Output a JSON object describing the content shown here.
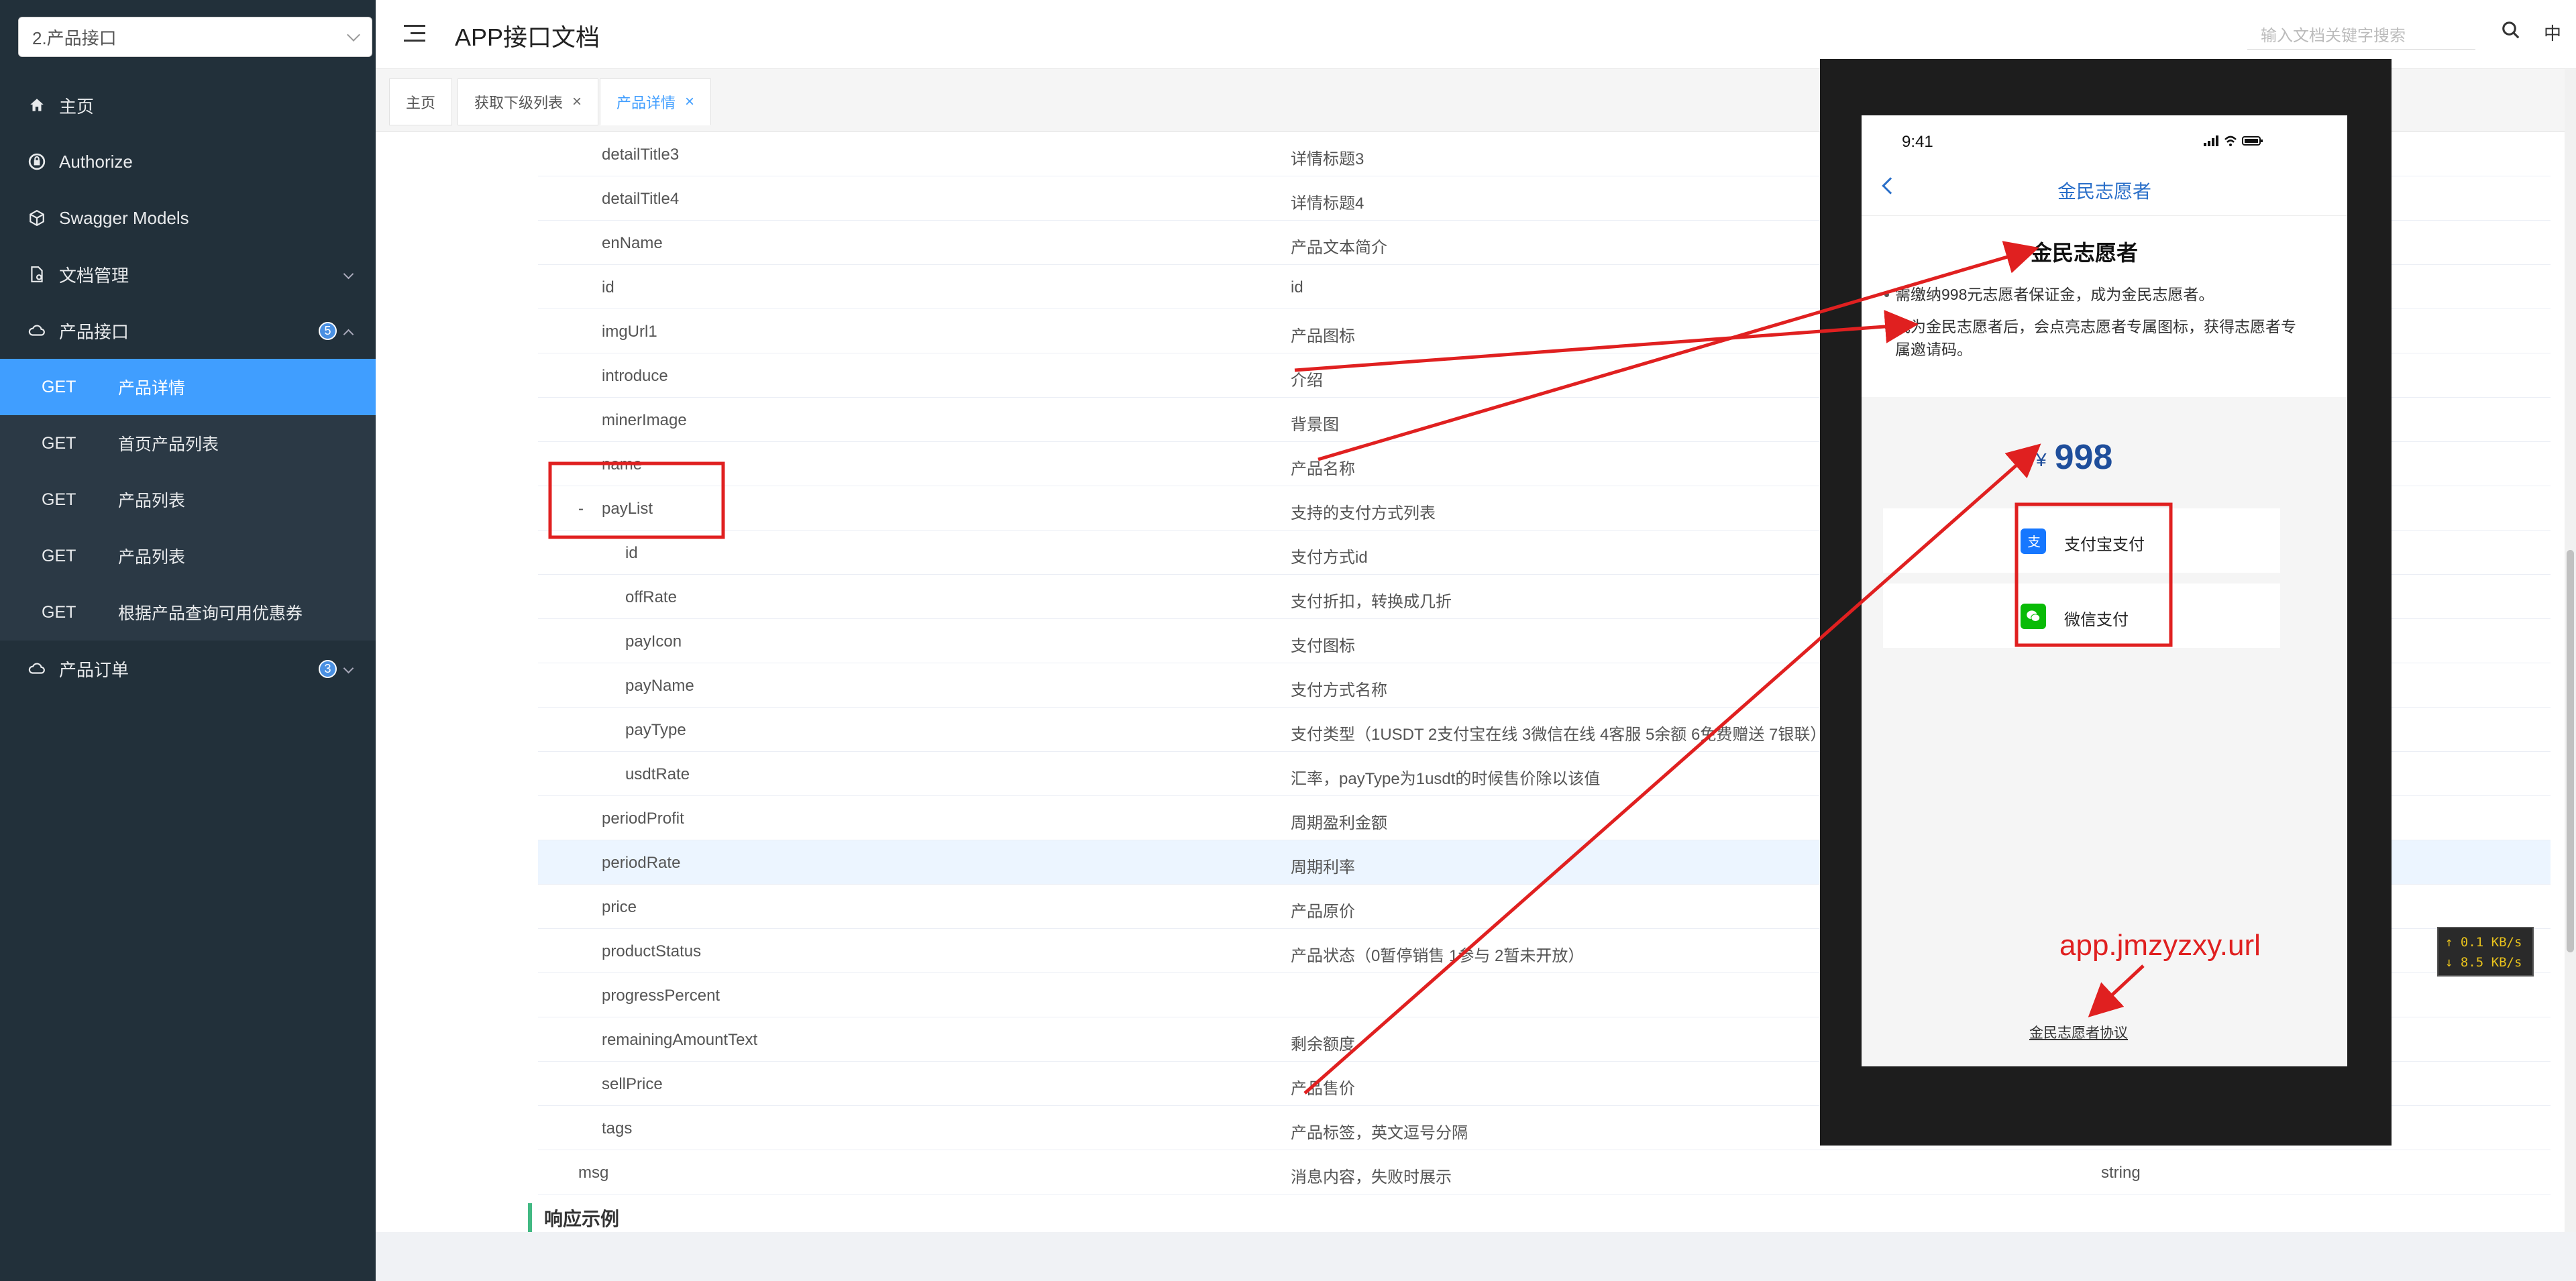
{
  "sidebar": {
    "project": "2.产品接口",
    "menu": [
      {
        "label": "主页",
        "icon": "home-icon"
      },
      {
        "label": "Authorize",
        "icon": "lock-icon"
      },
      {
        "label": "Swagger Models",
        "icon": "cube-icon"
      },
      {
        "label": "文档管理",
        "icon": "document-icon"
      },
      {
        "label": "产品接口",
        "icon": "cloud-icon",
        "badge": "5"
      },
      {
        "label": "产品订单",
        "icon": "cloud-icon",
        "badge": "3"
      }
    ],
    "sub_items": [
      {
        "method": "GET",
        "label": "产品详情"
      },
      {
        "method": "GET",
        "label": "首页产品列表"
      },
      {
        "method": "GET",
        "label": "产品列表"
      },
      {
        "method": "GET",
        "label": "产品列表"
      },
      {
        "method": "GET",
        "label": "根据产品查询可用优惠券"
      }
    ]
  },
  "header": {
    "title": "APP接口文档",
    "search_placeholder": "输入文档关键字搜索",
    "lang": "中"
  },
  "tabs": [
    {
      "label": "主页"
    },
    {
      "label": "获取下级列表"
    },
    {
      "label": "产品详情"
    }
  ],
  "close_symbol": "×",
  "table": {
    "rows": [
      {
        "name": "detailTitle3",
        "desc": "详情标题3",
        "type": ""
      },
      {
        "name": "detailTitle4",
        "desc": "详情标题4",
        "type": ""
      },
      {
        "name": "enName",
        "desc": "产品文本简介",
        "type": ""
      },
      {
        "name": "id",
        "desc": "id",
        "type": ""
      },
      {
        "name": "imgUrl1",
        "desc": "产品图标",
        "type": ""
      },
      {
        "name": "introduce",
        "desc": "介绍",
        "type": ""
      },
      {
        "name": "minerImage",
        "desc": "背景图",
        "type": ""
      },
      {
        "name": "name",
        "desc": "产品名称",
        "type": ""
      },
      {
        "name": "payList",
        "desc": "支持的支付方式列表",
        "type": "",
        "prefix": "-"
      },
      {
        "name": "id",
        "desc": "支付方式id",
        "type": ""
      },
      {
        "name": "offRate",
        "desc": "支付折扣，转换成几折",
        "type": ""
      },
      {
        "name": "payIcon",
        "desc": "支付图标",
        "type": ""
      },
      {
        "name": "payName",
        "desc": "支付方式名称",
        "type": ""
      },
      {
        "name": "payType",
        "desc": "支付类型（1USDT 2支付宝在线 3微信在线 4客服 5余额 6免费赠送 7银联）",
        "type": ""
      },
      {
        "name": "usdtRate",
        "desc": "汇率，payType为1usdt的时候售价除以该值",
        "type": ""
      },
      {
        "name": "periodProfit",
        "desc": "周期盈利金额",
        "type": ""
      },
      {
        "name": "periodRate",
        "desc": "周期利率",
        "type": ""
      },
      {
        "name": "price",
        "desc": "产品原价",
        "type": ""
      },
      {
        "name": "productStatus",
        "desc": "产品状态（0暂停销售 1参与 2暂未开放）",
        "type": ""
      },
      {
        "name": "progressPercent",
        "desc": "",
        "type": ""
      },
      {
        "name": "remainingAmountText",
        "desc": "剩余额度",
        "type": ""
      },
      {
        "name": "sellPrice",
        "desc": "产品售价",
        "type": ""
      },
      {
        "name": "tags",
        "desc": "产品标签，英文逗号分隔",
        "type": ""
      },
      {
        "name": "msg",
        "desc": "消息内容，失败时展示",
        "type": "string"
      }
    ],
    "section_title": "响应示例"
  },
  "phone": {
    "time": "9:41",
    "nav_title": "金民志愿者",
    "heading": "金民志愿者",
    "bullet1": "需缴纳998元志愿者保证金，成为金民志愿者。",
    "bullet2": "成为金民志愿者后，会点亮志愿者专属图标，获得志愿者专属邀请码。",
    "currency": "¥",
    "amount": "998",
    "pay_options": [
      {
        "label": "支付宝支付",
        "icon": "alipay-icon"
      },
      {
        "label": "微信支付",
        "icon": "wechat-icon"
      }
    ],
    "protocol": "金民志愿者协议"
  },
  "annotation": {
    "url_text": "app.jmzyzxy.url"
  },
  "speed": {
    "up": "↑ 0.1 KB/s",
    "down": "↓ 8.5 KB/s"
  },
  "colors": {
    "accent": "#409eff",
    "annotation": "#e02020",
    "sidebar": "#22303a"
  }
}
